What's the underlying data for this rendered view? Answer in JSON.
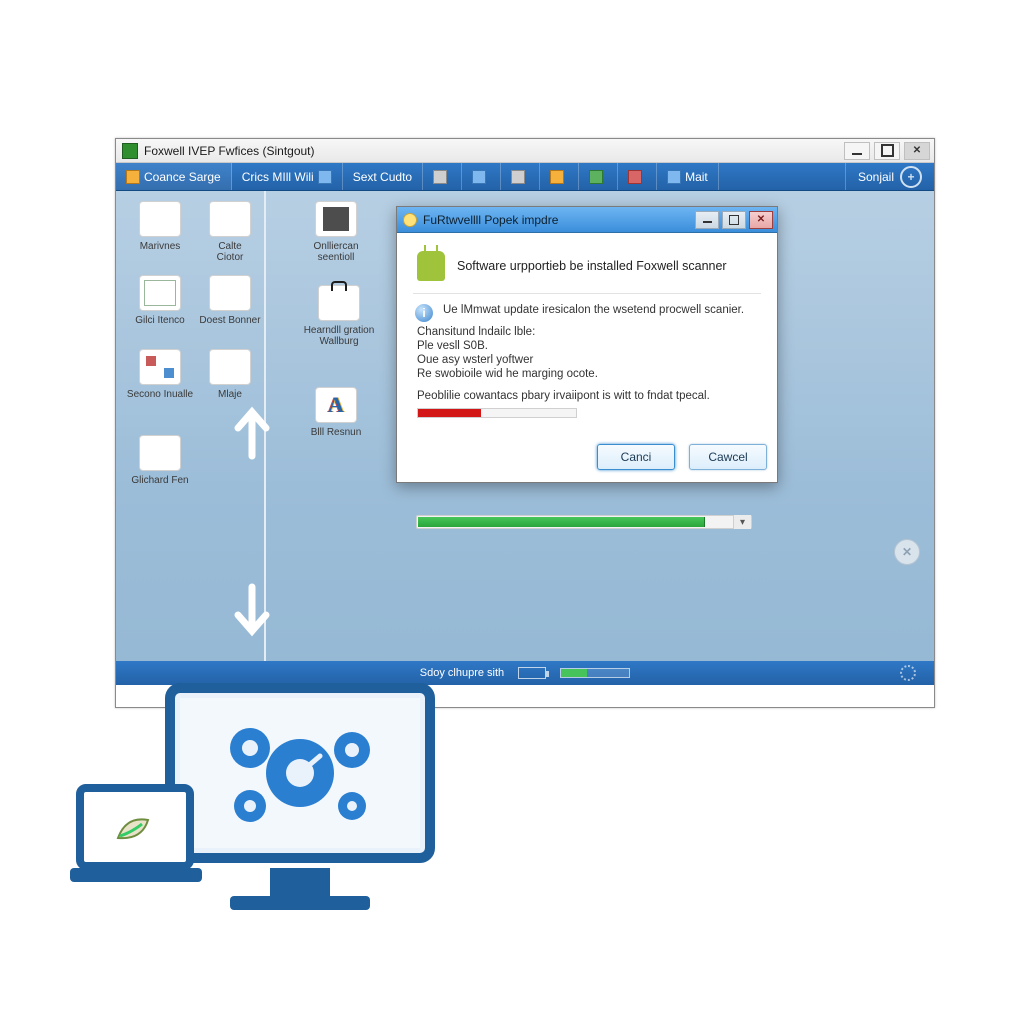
{
  "window": {
    "title": "Foxwell IVEP Fwfices (Sintgout)",
    "controls": {
      "min_title": "Minimize",
      "max_title": "Maximize",
      "close_title": "Close"
    }
  },
  "toolbar": {
    "items": [
      {
        "label": "Coance Sarge"
      },
      {
        "label": "Crics MIll Wili"
      },
      {
        "label": "Sext Cudto"
      },
      {
        "label": ""
      },
      {
        "label": ""
      },
      {
        "label": ""
      },
      {
        "label": ""
      },
      {
        "label": ""
      },
      {
        "label": ""
      },
      {
        "label": "Mait"
      }
    ],
    "right_label": "Sonjail",
    "add_title": "Add"
  },
  "desktop": {
    "icons": [
      {
        "label": "Marivnes"
      },
      {
        "label": "Calte\nCiotor"
      },
      {
        "label": "Gilci Itenco"
      },
      {
        "label": "Doest Bonner"
      },
      {
        "label": "Secono Inualle"
      },
      {
        "label": "Mlaje"
      },
      {
        "label": "Glichard Fen"
      },
      {
        "label": "Onlliercan\nseentioll"
      },
      {
        "label": "Hearndll gration\nWallburg"
      },
      {
        "label": "Blll Resnun"
      }
    ]
  },
  "dialog": {
    "title": "FuRtwvellll Popek impdre",
    "headline": "Software urpportieb be installed Foxwell scanner",
    "info_line": "Ue lMmwat update iresicalon the wsetend procwell scanier.",
    "lines": [
      "Chansitund lndailc lble:",
      "Ple vesll S0B.",
      "Oue asy wsterl yoftwer",
      "Re swobioile wid he marging ocote."
    ],
    "note": "Peoblilie cowantacs pbary irvaiipont is witt to fndat tpecal.",
    "buttons": {
      "primary": "Canci",
      "secondary": "Cawcel"
    }
  },
  "bg_progress": {
    "label": "",
    "dropdown_glyph": "▾"
  },
  "statusbar": {
    "text": "Sdoy clhupre sith"
  }
}
